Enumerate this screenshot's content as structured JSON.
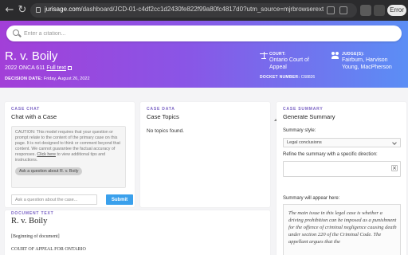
{
  "browser": {
    "url_domain": "jurisage.com",
    "url_rest": "/dashboard/JCD-01-c4df2cc1d2430fe822f99a80fc4817d0?utm_source=mjrbrowserextension&utm_medium=mapp&utm_ca...",
    "profile_label": "Error",
    "colors": {
      "chrome": "#2b2b2d",
      "urlbar": "#3a3a3c"
    }
  },
  "search": {
    "placeholder": "Enter a citation..."
  },
  "case": {
    "title": "R. v. Boily",
    "citation": "2022 ONCA 611",
    "full_text_label": "Full text",
    "decision_date_label": "DECISION DATE:",
    "decision_date": "Friday, August 26, 2022",
    "court_label": "COURT:",
    "court": "Ontario Court of Appeal",
    "docket_label": "DOCKET NUMBER:",
    "docket": "C68826",
    "judges_label": "JUDGE(S):",
    "judges": "Fairburn, Harvison Young, MacPherson"
  },
  "chat": {
    "kicker": "CASE CHAT",
    "title": "Chat with a Case",
    "caution_text": "CAUTION: This model requires that your question or prompt relate to the content of the primary case on this page. It is not designed to think or comment beyond that content. We cannot guarantee the factual accuracy of responses.",
    "caution_link": "Click here",
    "caution_after": "to view additional tips and instructions.",
    "suggestion": "Ask a question about R. v. Boily",
    "input_placeholder": "Ask a question about the case...",
    "submit_label": "Submit"
  },
  "data": {
    "kicker": "CASE DATA",
    "title": "Case Topics",
    "empty_text": "No topics found."
  },
  "summary": {
    "kicker": "CASE SUMMARY",
    "title": "Generate Summary",
    "style_label": "Summary style:",
    "style_value": "Legal conclusions",
    "refine_label": "Refine the summary with a specific direction:",
    "clear_label": "×",
    "appear_label": "Summary will appear here:",
    "text": "The main issue in this legal case is whether a driving prohibition can be imposed as a punishment for the offence of criminal negligence causing death under section 220 of the Criminal Code. The appellant argues that the"
  },
  "document": {
    "kicker": "DOCUMENT TEXT",
    "title": "R. v. Boily",
    "line1": "[Beginning of document]",
    "line2": "COURT OF APPEAL FOR ONTARIO"
  },
  "colors": {
    "accent": "#7a62c4",
    "submit": "#3aa0ec",
    "gradient_start": "#a23fd8",
    "gradient_end": "#5b8ef5"
  }
}
